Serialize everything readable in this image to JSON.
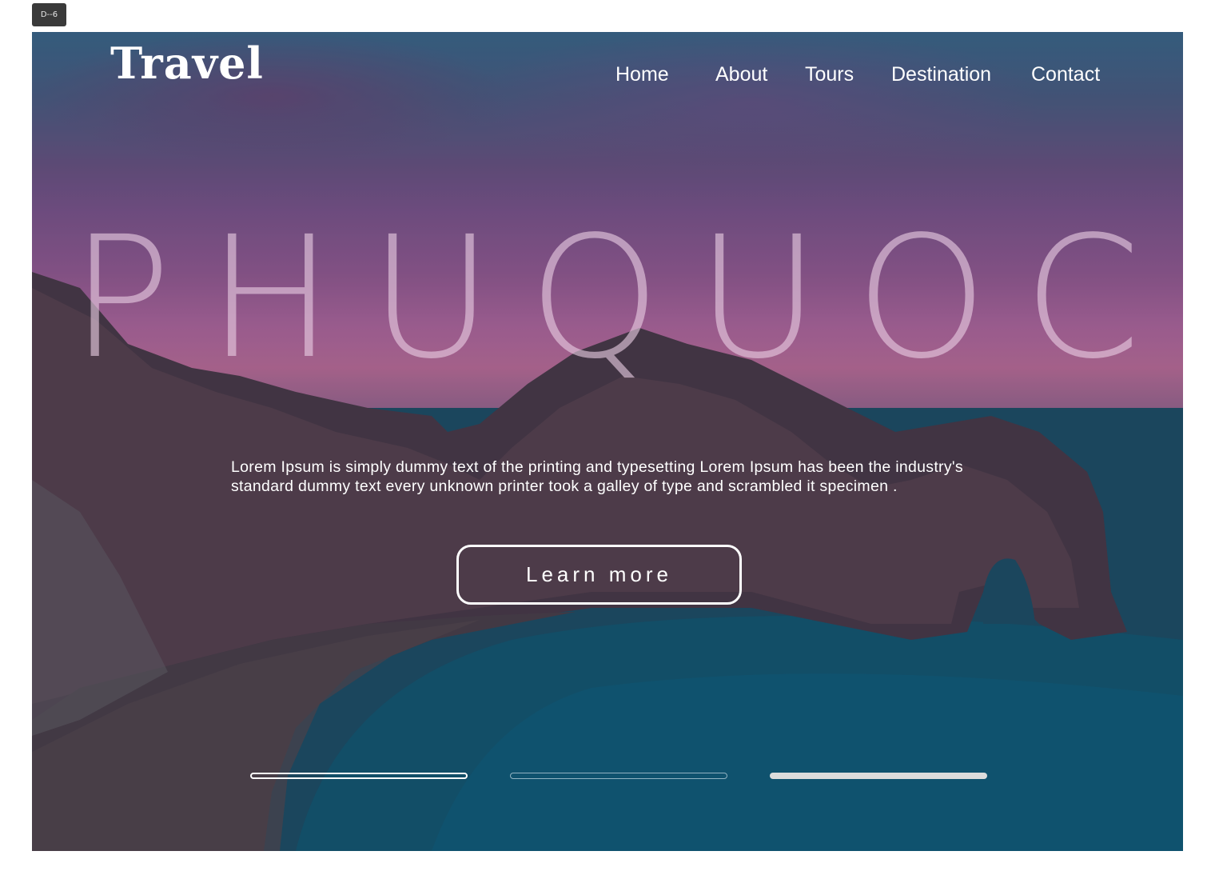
{
  "frame": {
    "label": "D--6"
  },
  "header": {
    "logo": "Travel",
    "nav": [
      {
        "label": "Home"
      },
      {
        "label": "About"
      },
      {
        "label": "Tours"
      },
      {
        "label": "Destination"
      },
      {
        "label": "Contact"
      }
    ]
  },
  "hero": {
    "headline": "PHUQUOC",
    "description_line1": "Lorem Ipsum is simply dummy text of the printing and typesetting  Lorem Ipsum has been the industry's",
    "description_line2": "standard dummy text every unknown printer took a galley of type and  scrambled it specimen .",
    "cta_label": "Learn more"
  },
  "slider": {
    "count": 3,
    "active_index": 3
  },
  "colors": {
    "text": "#ffffff",
    "headline": "#e8cde2",
    "indicator_active": "#dcdcdc"
  }
}
